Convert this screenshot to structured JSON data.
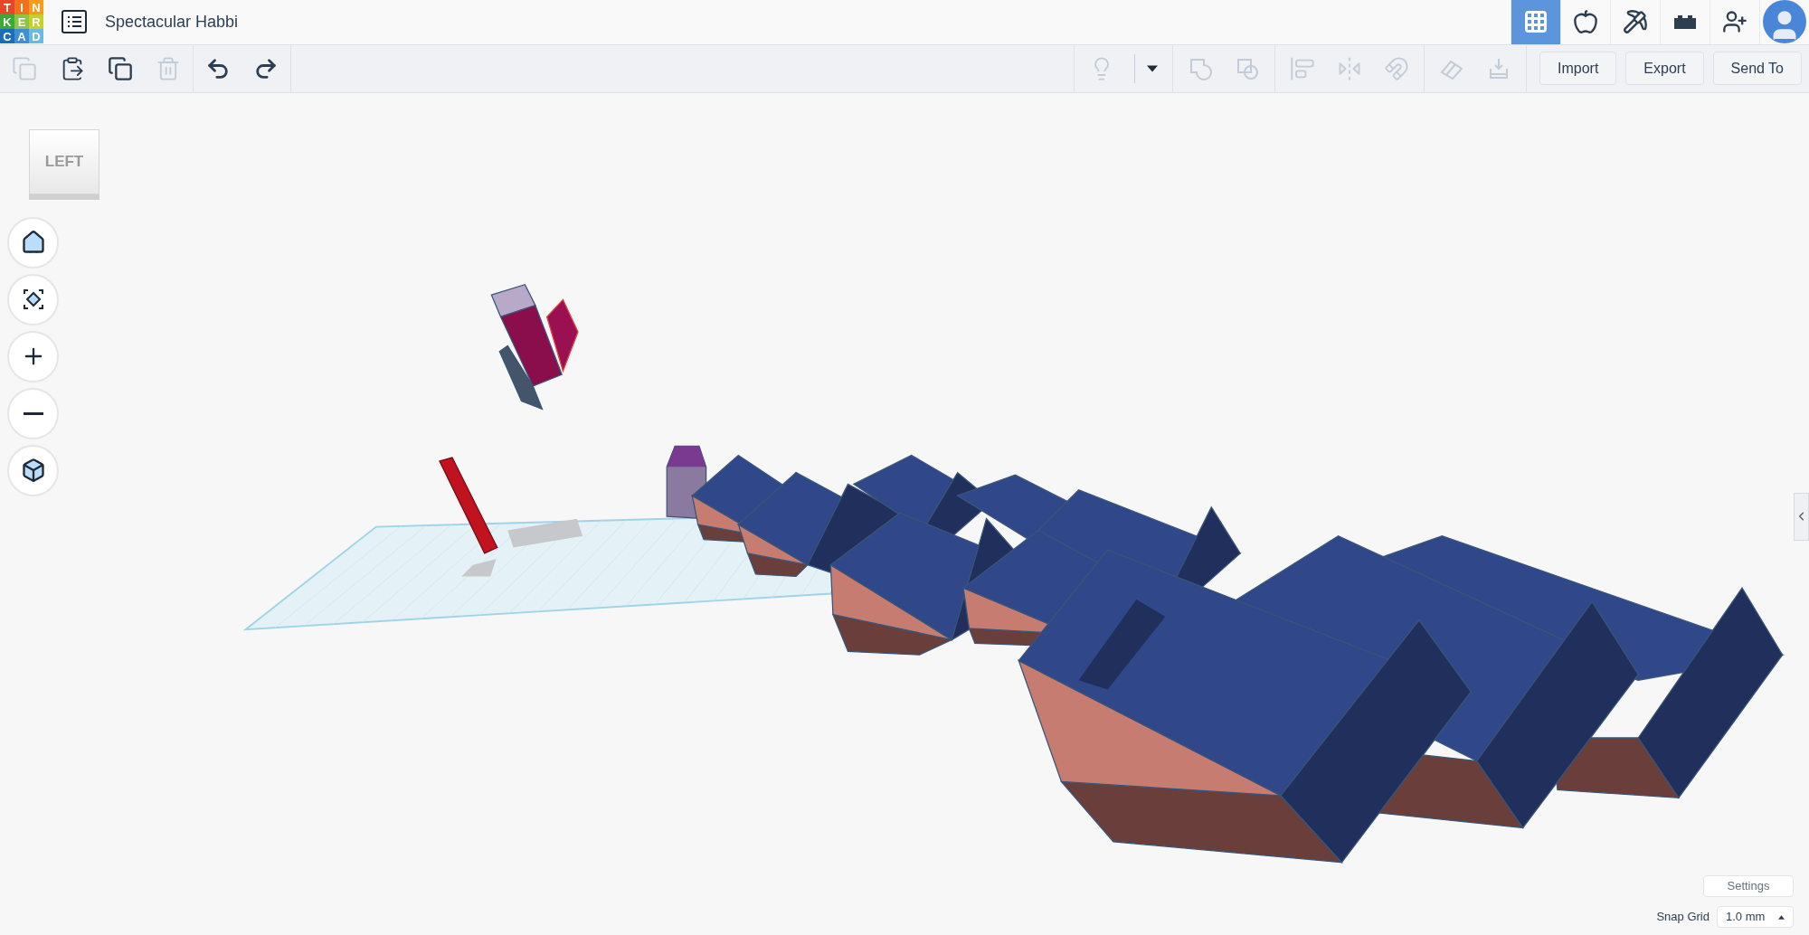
{
  "logo": {
    "letters": [
      {
        "char": "T",
        "color": "#e8462b"
      },
      {
        "char": "I",
        "color": "#f37021"
      },
      {
        "char": "N",
        "color": "#f89a1c"
      },
      {
        "char": "K",
        "color": "#3aaa35"
      },
      {
        "char": "E",
        "color": "#8cc63f"
      },
      {
        "char": "R",
        "color": "#c5d12a"
      },
      {
        "char": "C",
        "color": "#1b6db5"
      },
      {
        "char": "A",
        "color": "#3f8fd2"
      },
      {
        "char": "D",
        "color": "#6bb8e3"
      }
    ]
  },
  "title": "Spectacular Habbi",
  "view_tabs": [
    {
      "kind": "grid",
      "selected": true
    },
    {
      "kind": "apple",
      "selected": false
    },
    {
      "kind": "pickaxe",
      "selected": false
    },
    {
      "kind": "brick",
      "selected": false
    },
    {
      "kind": "add-user",
      "selected": false
    },
    {
      "kind": "avatar",
      "selected": false
    }
  ],
  "edit_tools": [
    [
      {
        "kind": "copy",
        "disabled": true
      },
      {
        "kind": "paste",
        "disabled": false
      },
      {
        "kind": "duplicate",
        "disabled": false
      },
      {
        "kind": "delete",
        "disabled": true
      }
    ],
    [
      {
        "kind": "undo",
        "disabled": false
      },
      {
        "kind": "redo",
        "disabled": false
      }
    ]
  ],
  "shape_tools": [
    [
      {
        "kind": "lightbulb",
        "disabled": true
      },
      {
        "kind": "caret",
        "disabled": false
      }
    ],
    [
      {
        "kind": "group",
        "disabled": true
      },
      {
        "kind": "ungroup",
        "disabled": true
      }
    ],
    [
      {
        "kind": "align",
        "disabled": true
      },
      {
        "kind": "mirror",
        "disabled": true
      },
      {
        "kind": "magnet",
        "disabled": true
      }
    ],
    [
      {
        "kind": "workplane",
        "disabled": true
      },
      {
        "kind": "drop",
        "disabled": true
      }
    ]
  ],
  "actions": [
    "Import",
    "Export",
    "Send To"
  ],
  "view_cube": {
    "label": "LEFT"
  },
  "nav_controls": [
    {
      "kind": "home"
    },
    {
      "kind": "fit"
    },
    {
      "kind": "zoom-in"
    },
    {
      "kind": "zoom-out"
    },
    {
      "kind": "ortho"
    }
  ],
  "settings_button": "Settings",
  "snap_grid": {
    "label": "Snap Grid",
    "value": "1.0 mm"
  }
}
